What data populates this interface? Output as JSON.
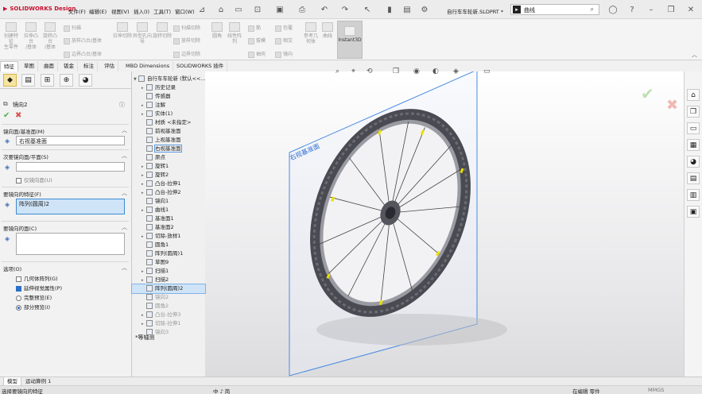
{
  "app": {
    "brand": "SOLIDWORKS Design",
    "menus": [
      "文件(F)",
      "编辑(E)",
      "视图(V)",
      "插入(I)",
      "工具(T)",
      "窗口(W)"
    ],
    "doc_title": "自行车车轮新.SLDPRT *",
    "search_text": "曲线"
  },
  "commands": {
    "big": [
      {
        "label": "凸台/基体\n扫描"
      },
      {
        "label": "旋转凸台\n/基体"
      },
      {
        "label": "创建特征\n生零件"
      },
      {
        "label": "拉伸凸台\n/基体"
      },
      {
        "label": "旋转凸台\n/基体"
      }
    ],
    "mid_rows": [
      "扫描",
      "放样凸台/基体",
      "边界凸台/基体"
    ],
    "cut_labels": [
      "拉伸切除",
      "异型孔向导",
      "旋转切除"
    ],
    "cut_rows": [
      "扫描切除",
      "放样切除",
      "边界切除"
    ],
    "features": [
      {
        "label": "圆角"
      },
      {
        "label": "线性阵\n列"
      },
      {
        "label": "筋"
      },
      {
        "label": "拔模"
      },
      {
        "label": "抽壳"
      },
      {
        "label": "包覆"
      },
      {
        "label": "相交"
      },
      {
        "label": "镜向"
      },
      {
        "label": "参考几\n何体"
      },
      {
        "label": "曲线"
      }
    ],
    "instant3d": "Instant3D"
  },
  "tabs": [
    "特征",
    "草图",
    "曲面",
    "钣金",
    "标注",
    "评估",
    "MBD Dimensions",
    "SOLIDWORKS 插件"
  ],
  "active_tab": 0,
  "property_manager": {
    "title": "镜向2",
    "sections": {
      "mirror_plane": {
        "title": "镜向面/基准面(M)",
        "value": "右视基准面"
      },
      "secondary_plane": {
        "title": "次要镜向面/平面(S)",
        "value": "",
        "checkbox": "仅镜向面(U)"
      },
      "features": {
        "title": "要镜向的特征(F)",
        "value": "阵列(圆周)2"
      },
      "faces": {
        "title": "要镜向的面(C)",
        "value": ""
      },
      "options": {
        "title": "选项(O)",
        "items": [
          {
            "label": "几何体阵列(G)",
            "type": "check",
            "checked": false
          },
          {
            "label": "延伸视觉属性(P)",
            "type": "check",
            "checked": true
          },
          {
            "label": "完整预览(E)",
            "type": "radio",
            "checked": false
          },
          {
            "label": "部分预览(I)",
            "type": "radio",
            "checked": true
          }
        ]
      }
    }
  },
  "tree": {
    "root": "自行车车轮新 (默认<<...",
    "items": [
      {
        "label": "历史记录",
        "state": "normal"
      },
      {
        "label": "传感器",
        "state": "normal"
      },
      {
        "label": "注解",
        "state": "normal"
      },
      {
        "label": "实体(1)",
        "state": "normal"
      },
      {
        "label": "材质 <未指定>",
        "state": "normal"
      },
      {
        "label": "前视基准面",
        "state": "normal"
      },
      {
        "label": "上视基准面",
        "state": "normal"
      },
      {
        "label": "右视基准面",
        "state": "boxed"
      },
      {
        "label": "原点",
        "state": "normal"
      },
      {
        "label": "旋转1",
        "state": "normal"
      },
      {
        "label": "旋转2",
        "state": "normal"
      },
      {
        "label": "凸台-拉伸1",
        "state": "normal"
      },
      {
        "label": "凸台-拉伸2",
        "state": "normal"
      },
      {
        "label": "镜向1",
        "state": "normal"
      },
      {
        "label": "曲线1",
        "state": "normal"
      },
      {
        "label": "基准面1",
        "state": "normal"
      },
      {
        "label": "基准面2",
        "state": "normal"
      },
      {
        "label": "切除-放样1",
        "state": "normal"
      },
      {
        "label": "圆角1",
        "state": "normal"
      },
      {
        "label": "阵列(圆周)1",
        "state": "normal"
      },
      {
        "label": "草图9",
        "state": "normal"
      },
      {
        "label": "扫描1",
        "state": "normal"
      },
      {
        "label": "扫描2",
        "state": "normal"
      },
      {
        "label": "阵列(圆周)2",
        "state": "selected"
      },
      {
        "label": "镜向2",
        "state": "dim"
      },
      {
        "label": "圆角2",
        "state": "dim"
      },
      {
        "label": "凸台-拉伸3",
        "state": "dim"
      },
      {
        "label": "切除-拉伸1",
        "state": "dim"
      },
      {
        "label": "镜向3",
        "state": "dim"
      }
    ]
  },
  "viewport": {
    "plane_label": "右视基准面",
    "view_label": "*等轴测"
  },
  "bottom_tabs": [
    "模型",
    "运动算例 1"
  ],
  "status": {
    "left": "选择要镜向的特征",
    "ime": "中 ♪ 简",
    "mode": "在编辑 零件",
    "units": "MMGS"
  },
  "colors": {
    "accent": "#2f6fd0",
    "brand": "#c8102e",
    "confirm": "#4caf50",
    "cancel": "#d9534f",
    "spoke_marker": "#e8e000"
  }
}
